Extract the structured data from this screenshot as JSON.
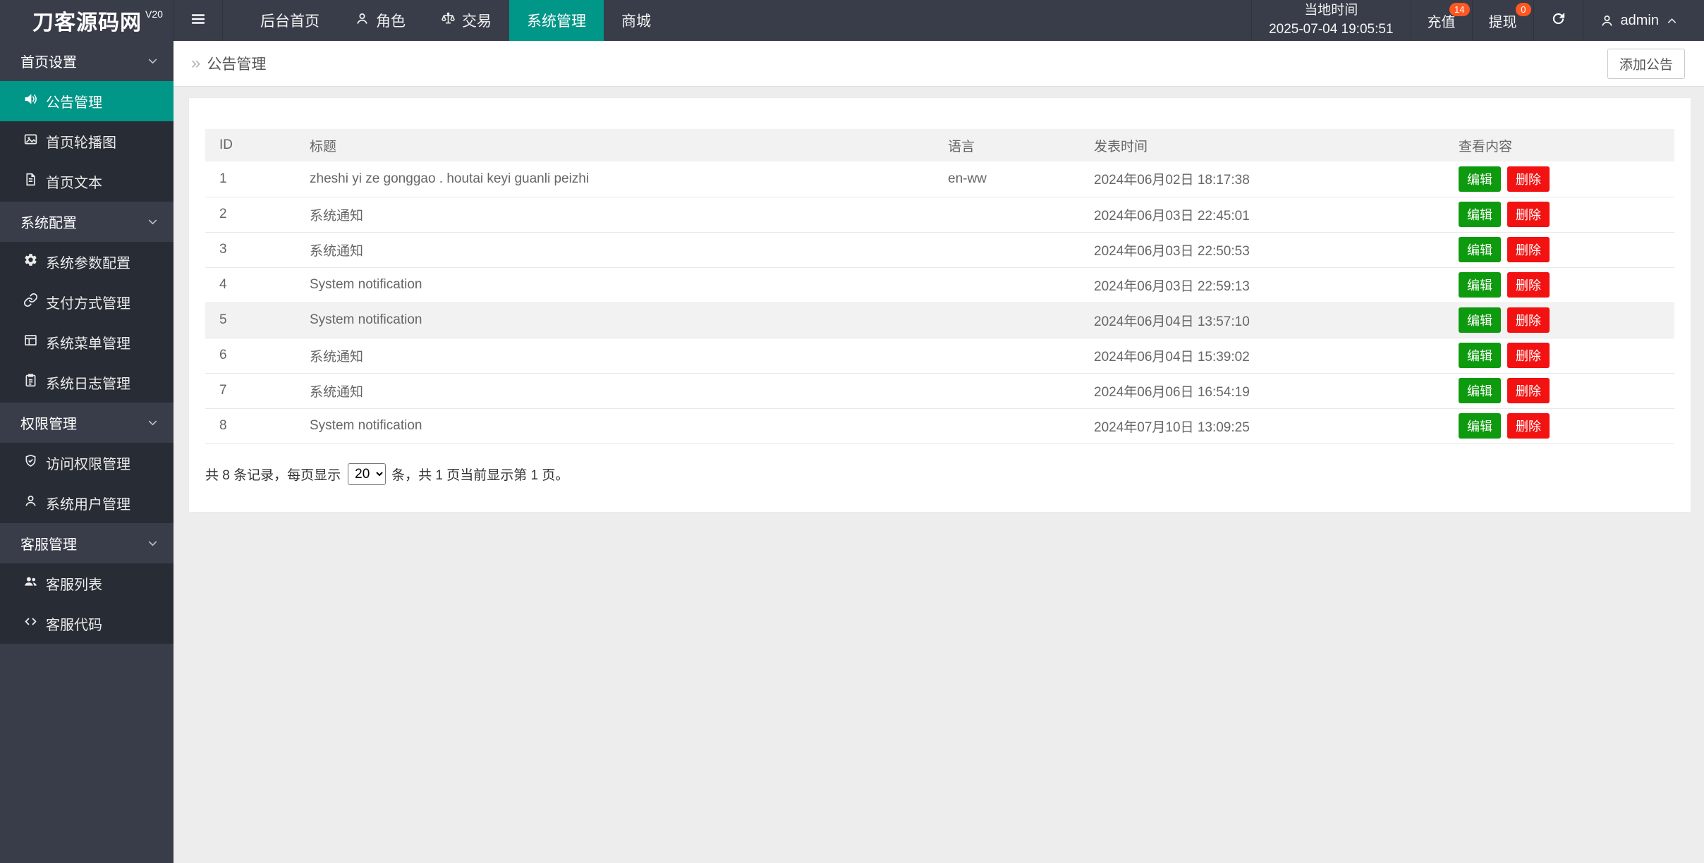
{
  "topbar": {
    "logo": {
      "title": "刀客源码网",
      "version": "V20"
    },
    "nav": [
      {
        "label": "后台首页",
        "icon": null,
        "active": false
      },
      {
        "label": "角色",
        "icon": "user-icon",
        "active": false
      },
      {
        "label": "交易",
        "icon": "scales-icon",
        "active": false
      },
      {
        "label": "系统管理",
        "icon": null,
        "active": true
      },
      {
        "label": "商城",
        "icon": null,
        "active": false
      }
    ],
    "local_time_label": "当地时间",
    "local_time_value": "2025-07-04 19:05:51",
    "recharge": {
      "label": "充值",
      "badge": "14"
    },
    "withdraw": {
      "label": "提现",
      "badge": "0"
    },
    "user": {
      "name": "admin"
    }
  },
  "sidebar": {
    "sections": [
      {
        "label": "首页设置",
        "items": [
          {
            "label": "公告管理",
            "icon": "speaker-icon",
            "active": true
          },
          {
            "label": "首页轮播图",
            "icon": "image-icon",
            "active": false
          },
          {
            "label": "首页文本",
            "icon": "document-icon",
            "active": false
          }
        ]
      },
      {
        "label": "系统配置",
        "items": [
          {
            "label": "系统参数配置",
            "icon": "gear-icon",
            "active": false
          },
          {
            "label": "支付方式管理",
            "icon": "link-icon",
            "active": false
          },
          {
            "label": "系统菜单管理",
            "icon": "window-icon",
            "active": false
          },
          {
            "label": "系统日志管理",
            "icon": "clipboard-icon",
            "active": false
          }
        ]
      },
      {
        "label": "权限管理",
        "items": [
          {
            "label": "访问权限管理",
            "icon": "shield-check-icon",
            "active": false
          },
          {
            "label": "系统用户管理",
            "icon": "user-icon",
            "active": false
          }
        ]
      },
      {
        "label": "客服管理",
        "items": [
          {
            "label": "客服列表",
            "icon": "users-icon",
            "active": false
          },
          {
            "label": "客服代码",
            "icon": "code-icon",
            "active": false
          }
        ]
      }
    ]
  },
  "breadcrumb": {
    "arrow": "»",
    "title": "公告管理"
  },
  "toolbar": {
    "add_button": "添加公告"
  },
  "table": {
    "columns": [
      "ID",
      "标题",
      "语言",
      "发表时间",
      "查看内容"
    ],
    "edit_label": "编辑",
    "delete_label": "删除",
    "rows": [
      {
        "id": "1",
        "title": "zheshi yi ze gonggao . houtai keyi guanli peizhi",
        "lang": "en-ww",
        "time": "2024年06月02日 18:17:38",
        "highlighted": false
      },
      {
        "id": "2",
        "title": "系统通知",
        "lang": "",
        "time": "2024年06月03日 22:45:01",
        "highlighted": false
      },
      {
        "id": "3",
        "title": "系统通知",
        "lang": "",
        "time": "2024年06月03日 22:50:53",
        "highlighted": false
      },
      {
        "id": "4",
        "title": "System notification",
        "lang": "",
        "time": "2024年06月03日 22:59:13",
        "highlighted": false
      },
      {
        "id": "5",
        "title": "System notification",
        "lang": "",
        "time": "2024年06月04日 13:57:10",
        "highlighted": true
      },
      {
        "id": "6",
        "title": "系统通知",
        "lang": "",
        "time": "2024年06月04日 15:39:02",
        "highlighted": false
      },
      {
        "id": "7",
        "title": "系统通知",
        "lang": "",
        "time": "2024年06月06日 16:54:19",
        "highlighted": false
      },
      {
        "id": "8",
        "title": "System notification",
        "lang": "",
        "time": "2024年07月10日 13:09:25",
        "highlighted": false
      }
    ]
  },
  "pagination": {
    "prefix": "共 8 条记录，每页显示",
    "page_size": "20",
    "options": [
      "20"
    ],
    "suffix": "条，共 1 页当前显示第 1 页。"
  },
  "colors": {
    "topbar_bg": "#393D49",
    "sidebar_child_bg": "#282c35",
    "accent_teal": "#009688",
    "badge_orange": "#FF5722",
    "edit_green": "#0e9a0e",
    "delete_red": "#f21212",
    "page_bg": "#ededed",
    "table_header_bg": "#f2f2f2"
  }
}
